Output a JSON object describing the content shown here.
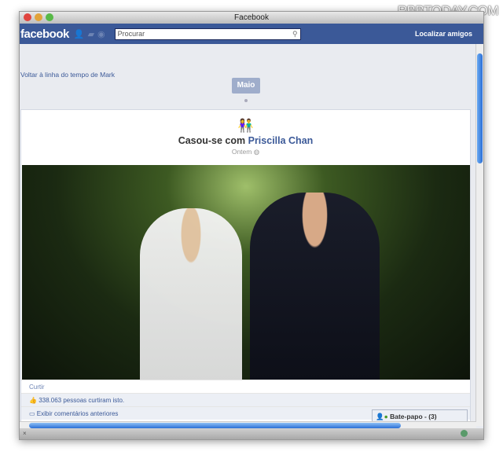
{
  "watermark": "RBBTODAY.COM",
  "window": {
    "title": "Facebook"
  },
  "header": {
    "logo": "facebook",
    "search_placeholder": "Procurar",
    "find_friends": "Localizar amigos"
  },
  "main": {
    "back_link": "Voltar à linha do tempo de Mark",
    "month_label": "Maio",
    "event": {
      "prefix": "Casou-se com ",
      "person": "Priscilla Chan",
      "time": "Ontem"
    },
    "actions": {
      "like": "Curtir",
      "likes_count": "338.063 pessoas curtiram isto.",
      "show_comments": "Exibir comentários anteriores"
    }
  },
  "chat": {
    "label": "Bate-papo - (3)"
  },
  "status": {
    "close": "×"
  },
  "colors": {
    "brand": "#3b5998",
    "scroll": "#2a6fd6"
  }
}
